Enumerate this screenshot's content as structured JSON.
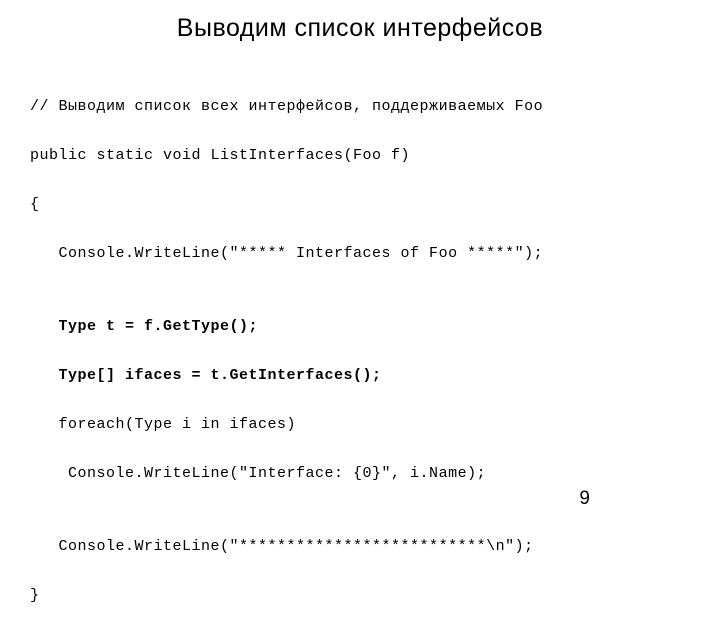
{
  "title": "Выводим список интерфейсов",
  "code": {
    "line1": "// Выводим список всех интерфейсов, поддерживаемых Foo",
    "line2": "public static void ListInterfaces(Foo f)",
    "line3": "{",
    "line4": "   Console.WriteLine(\"***** Interfaces of Foo *****\");",
    "line5": "",
    "line6": "   Type t = f.GetType();",
    "line7": "   Type[] ifaces = t.GetInterfaces();",
    "line8": "   foreach(Type i in ifaces)",
    "line9": "    Console.WriteLine(\"Interface: {0}\", i.Name);",
    "line10": "",
    "line11": "   Console.WriteLine(\"**************************\\n\");",
    "line12": "}"
  },
  "page_number": "9"
}
